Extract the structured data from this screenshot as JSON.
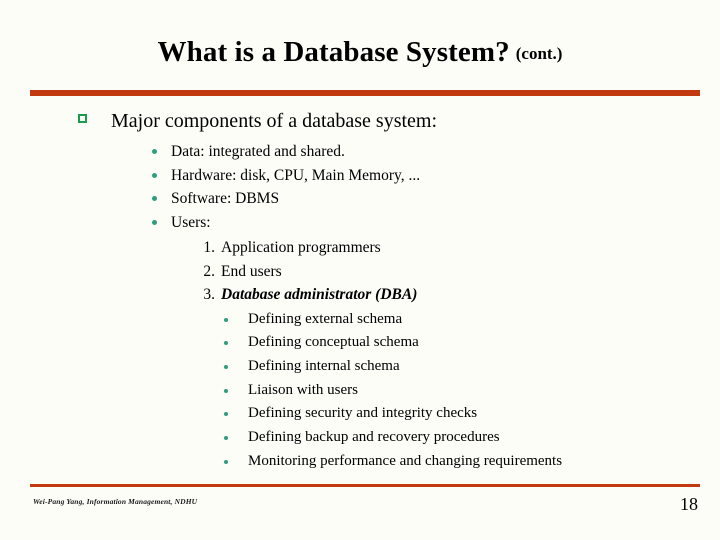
{
  "slide": {
    "title_main": "What is a Database System?",
    "title_cont": "(cont.)",
    "accent_color": "#c2380f",
    "bullet_square_color": "#1a9c4f",
    "bullet_dot_color": "#2e9e7e",
    "background_color": "#fdfdf8"
  },
  "body": {
    "level1": {
      "bullet_icon": "hollow-square-bullet",
      "text": "Major components of a database system:"
    },
    "level2": [
      {
        "bullet_icon": "round-dot-bullet",
        "text": "Data: integrated and shared."
      },
      {
        "bullet_icon": "round-dot-bullet",
        "text": "Hardware: disk, CPU, Main Memory, ..."
      },
      {
        "bullet_icon": "round-dot-bullet",
        "text": "Software: DBMS"
      },
      {
        "bullet_icon": "round-dot-bullet",
        "text": "Users:"
      }
    ],
    "level3": [
      {
        "number": "1.",
        "text": "Application programmers",
        "emphasis": false
      },
      {
        "number": "2.",
        "text": "End users",
        "emphasis": false
      },
      {
        "number": "3.",
        "text": "Database administrator (DBA)",
        "emphasis": true
      }
    ],
    "level4": [
      {
        "bullet_icon": "round-dot-bullet",
        "text": "Defining external schema"
      },
      {
        "bullet_icon": "round-dot-bullet",
        "text": "Defining conceptual schema"
      },
      {
        "bullet_icon": "round-dot-bullet",
        "text": "Defining internal schema"
      },
      {
        "bullet_icon": "round-dot-bullet",
        "text": "Liaison with users"
      },
      {
        "bullet_icon": "round-dot-bullet",
        "text": "Defining security and integrity checks"
      },
      {
        "bullet_icon": "round-dot-bullet",
        "text": "Defining backup and recovery procedures"
      },
      {
        "bullet_icon": "round-dot-bullet",
        "text": "Monitoring performance and changing requirements"
      }
    ]
  },
  "footer": {
    "credit": "Wei-Pang Yang, Information Management, NDHU",
    "page_number": "18"
  }
}
